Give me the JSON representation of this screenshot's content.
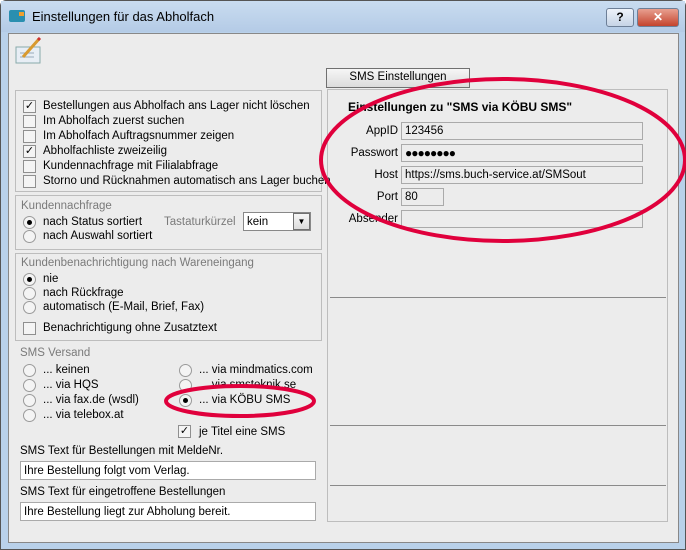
{
  "window": {
    "title": "Einstellungen für das Abholfach",
    "help": "?",
    "close": "✕"
  },
  "sms_settings_button": "SMS Einstellungen",
  "general_options": [
    {
      "label": "Bestellungen aus Abholfach ans Lager nicht löschen",
      "checked": true
    },
    {
      "label": "Im Abholfach zuerst suchen",
      "checked": false
    },
    {
      "label": "Im Abholfach Auftragsnummer zeigen",
      "checked": false
    },
    {
      "label": "Abholfachliste zweizeilig",
      "checked": true
    },
    {
      "label": "Kundennachfrage mit Filialabfrage",
      "checked": false
    },
    {
      "label": "Storno und Rücknahmen automatisch ans Lager buchen",
      "checked": false
    }
  ],
  "kundennachfrage": {
    "title": "Kundennachfrage",
    "options": [
      "nach Status sortiert",
      "nach Auswahl sortiert"
    ],
    "selected": 0,
    "shortcut_label": "Tastaturkürzel",
    "shortcut_value": "kein"
  },
  "benachrichtigung": {
    "title": "Kundenbenachrichtigung nach Wareneingang",
    "options": [
      "nie",
      "nach Rückfrage",
      "automatisch (E-Mail, Brief, Fax)"
    ],
    "selected": 0,
    "no_extra_text": "Benachrichtigung ohne Zusatztext"
  },
  "sms_versand": {
    "title": "SMS Versand",
    "left": [
      "... keinen",
      "... via HQS",
      "... via fax.de (wsdl)",
      "... via telebox.at"
    ],
    "right": [
      "... via mindmatics.com",
      "... via smsteknik.se",
      "... via KÖBU SMS"
    ],
    "selected": "... via KÖBU SMS",
    "per_title": "je Titel eine SMS"
  },
  "sms_text_order": {
    "label": "SMS Text für Bestellungen mit MeldeNr.",
    "value": "Ihre Bestellung folgt vom Verlag."
  },
  "sms_text_arrived": {
    "label": "SMS Text für eingetroffene Bestellungen",
    "value": "Ihre Bestellung liegt zur Abholung bereit."
  },
  "sms_config": {
    "title": "Einstellungen zu \"SMS via KÖBU SMS\"",
    "appid_label": "AppID",
    "appid": "123456",
    "password_label": "Passwort",
    "password": "●●●●●●●●",
    "host_label": "Host",
    "host": "https://sms.buch-service.at/SMSout",
    "port_label": "Port",
    "port": "80",
    "sender_label": "Absender",
    "sender": ""
  },
  "annotation_color": "#e0003c"
}
